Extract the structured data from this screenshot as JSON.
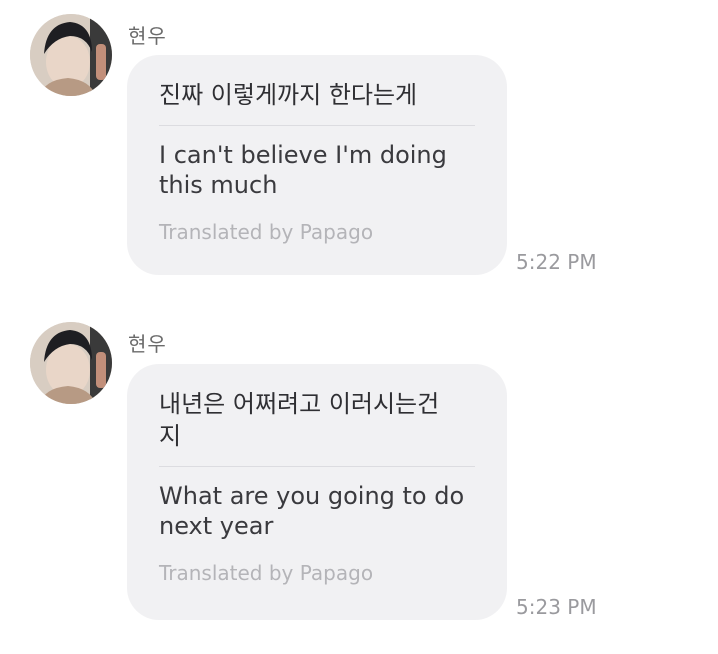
{
  "messages": [
    {
      "sender": "현우",
      "original": "진짜 이렇게까지 한다는게",
      "translation": "I can't believe I'm doing this much",
      "credit": "Translated by Papago",
      "time": "5:22 PM"
    },
    {
      "sender": "현우",
      "original": "내년은 어쩌려고 이러시는건지",
      "translation": "What are you going to do next year",
      "credit": "Translated by Papago",
      "time": "5:23 PM"
    }
  ],
  "icons": {
    "avatar": "user-avatar-photo"
  }
}
